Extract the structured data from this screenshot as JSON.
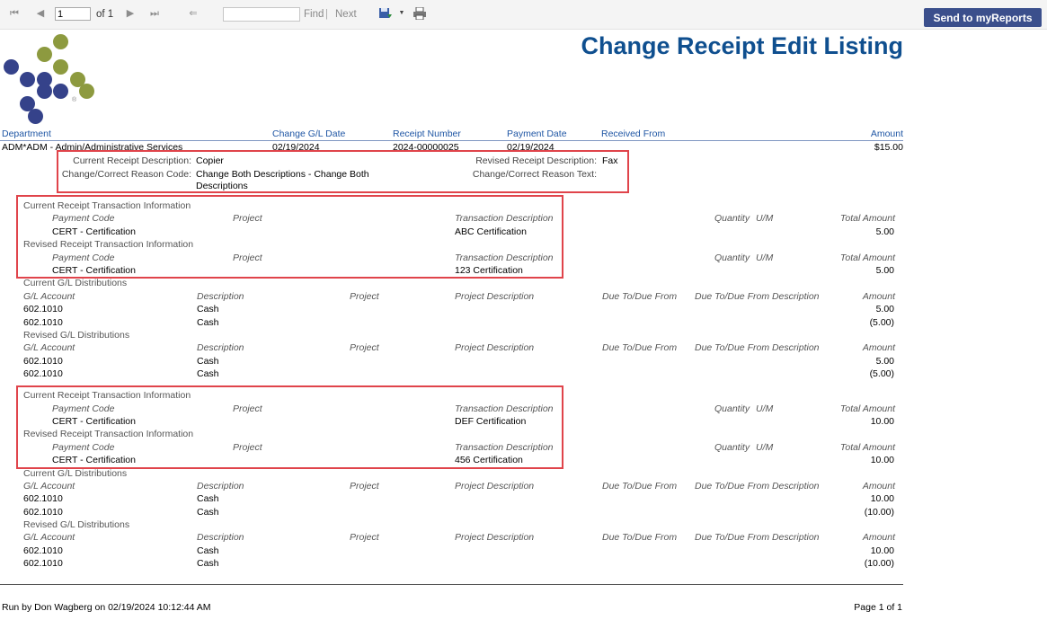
{
  "toolbar": {
    "page_value": "1",
    "page_of": "of 1",
    "find_label": "Find",
    "next_label": "Next",
    "send_label": "Send to myReports"
  },
  "report": {
    "title": "Change Receipt Edit Listing",
    "columns": {
      "department": "Department",
      "change_date": "Change G/L Date",
      "receipt_number": "Receipt Number",
      "payment_date": "Payment Date",
      "received_from": "Received From",
      "amount": "Amount"
    },
    "row": {
      "department": "ADM*ADM - Admin/Administrative Services",
      "change_date": "02/19/2024",
      "receipt_number": "2024-00000025",
      "payment_date": "02/19/2024",
      "amount": "$15.00"
    },
    "desc": {
      "current_label": "Current Receipt Description:",
      "current_value": "Copier",
      "revised_label": "Revised Receipt Description:",
      "revised_value": "Fax",
      "reason_code_label": "Change/Correct Reason Code:",
      "reason_code_value_1": "Change Both Descriptions - Change Both",
      "reason_code_value_2": "Descriptions",
      "reason_text_label": "Change/Correct Reason Text:"
    },
    "sec": {
      "current_tx": "Current Receipt Transaction Information",
      "revised_tx": "Revised Receipt Transaction Information",
      "current_gl": "Current G/L Distributions",
      "revised_gl": "Revised G/L Distributions"
    },
    "txh": {
      "payment_code": "Payment Code",
      "project": "Project",
      "tx_desc": "Transaction Description",
      "quantity": "Quantity",
      "um": "U/M",
      "total": "Total Amount"
    },
    "glh": {
      "account": "G/L Account",
      "description": "Description",
      "project": "Project",
      "project_desc": "Project Description",
      "due_to": "Due To/Due From",
      "due_to_desc": "Due To/Due From Description",
      "amount": "Amount"
    },
    "groups": [
      {
        "cur_code": "CERT - Certification",
        "cur_desc": "ABC Certification",
        "cur_total": "5.00",
        "rev_code": "CERT - Certification",
        "rev_desc": "123 Certification",
        "rev_total": "5.00",
        "cur_gl": [
          [
            "602.1010",
            "Cash",
            "5.00"
          ],
          [
            "602.1010",
            "Cash",
            "(5.00)"
          ]
        ],
        "rev_gl": [
          [
            "602.1010",
            "Cash",
            "5.00"
          ],
          [
            "602.1010",
            "Cash",
            "(5.00)"
          ]
        ]
      },
      {
        "cur_code": "CERT - Certification",
        "cur_desc": "DEF Certification",
        "cur_total": "10.00",
        "rev_code": "CERT - Certification",
        "rev_desc": "456 Certification",
        "rev_total": "10.00",
        "cur_gl": [
          [
            "602.1010",
            "Cash",
            "10.00"
          ],
          [
            "602.1010",
            "Cash",
            "(10.00)"
          ]
        ],
        "rev_gl": [
          [
            "602.1010",
            "Cash",
            "10.00"
          ],
          [
            "602.1010",
            "Cash",
            "(10.00)"
          ]
        ]
      }
    ],
    "footer": {
      "run_by": "Run by Don Wagberg on 02/19/2024 10:12:44 AM",
      "page": "Page 1 of 1"
    }
  },
  "colors": {
    "title": "#0f4f8f",
    "header": "#1f56a4",
    "button": "#3b4f8c",
    "highlight": "#e0444b",
    "logo_navy": "#35428a",
    "logo_olive": "#8d9a3f"
  }
}
